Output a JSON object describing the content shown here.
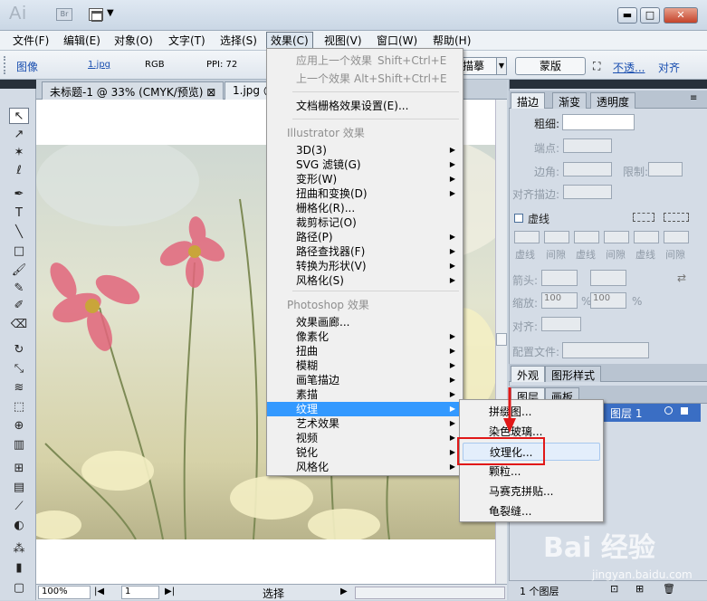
{
  "title_bar": {
    "app_logo": "Ai",
    "bridge_label": "Br",
    "arrange_icon": "arrange-documents-icon",
    "min": "▬",
    "max": "□",
    "close": "✕"
  },
  "menubar": [
    "文件(F)",
    "编辑(E)",
    "对象(O)",
    "文字(T)",
    "选择(S)",
    "效果(C)",
    "视图(V)",
    "窗口(W)",
    "帮助(H)"
  ],
  "control_bar": {
    "label": "图像",
    "file": "1.jpg",
    "mode": "RGB",
    "ppi": "PPI: 72",
    "trace": "描摹",
    "mask": "蒙版",
    "opacity": "不透...",
    "align": "对齐"
  },
  "doc_tabs": [
    {
      "label": "未标题-1 @ 33% (CMYK/预览)",
      "close": "⊠"
    },
    {
      "label": "1.jpg @"
    }
  ],
  "status_bar": {
    "zoom": "100%",
    "page": "1",
    "tool": "选择"
  },
  "effect_menu": {
    "top": [
      {
        "label": "应用上一个效果",
        "shortcut": "Shift+Ctrl+E",
        "disabled": true
      },
      {
        "label": "上一个效果",
        "shortcut": "Alt+Shift+Ctrl+E",
        "disabled": true
      },
      {
        "label": "文档栅格效果设置(E)..."
      }
    ],
    "illustrator_header": "Illustrator 效果",
    "illustrator": [
      "3D(3)",
      "SVG 滤镜(G)",
      "变形(W)",
      "扭曲和变换(D)",
      "栅格化(R)...",
      "裁剪标记(O)",
      "路径(P)",
      "路径查找器(F)",
      "转换为形状(V)",
      "风格化(S)"
    ],
    "illustrator_submenu": [
      true,
      true,
      true,
      true,
      false,
      false,
      true,
      true,
      true,
      true
    ],
    "photoshop_header": "Photoshop 效果",
    "photoshop": [
      "效果画廊...",
      "像素化",
      "扭曲",
      "模糊",
      "画笔描边",
      "素描",
      "纹理",
      "艺术效果",
      "视频",
      "锐化",
      "风格化"
    ],
    "photoshop_submenu": [
      false,
      true,
      true,
      true,
      true,
      true,
      true,
      true,
      true,
      true,
      true
    ],
    "highlighted": "纹理"
  },
  "texture_submenu": [
    "拼缀图...",
    "染色玻璃...",
    "纹理化...",
    "颗粒...",
    "马赛克拼贴...",
    "龟裂缝..."
  ],
  "texture_selected": "纹理化...",
  "panels": {
    "stroke_tabs": [
      "描边",
      "渐变",
      "透明度"
    ],
    "weight_label": "粗细:",
    "cap_label": "端点:",
    "corner_label": "边角:",
    "limit_label": "限制:",
    "align_stroke_label": "对齐描边:",
    "dashed_label": "虚线",
    "dash_cells": [
      "虚线",
      "间隙",
      "虚线",
      "间隙",
      "虚线",
      "间隙"
    ],
    "arrow_label": "箭头:",
    "scale_label": "缩放:",
    "scale_values": [
      "100",
      "100"
    ],
    "percent": "%",
    "align_label": "对齐:",
    "profile_label": "配置文件:",
    "appearance_tabs": [
      "外观",
      "图形样式"
    ],
    "layers_tabs": [
      "图层",
      "画板"
    ],
    "layer_name": "图层 1",
    "layer_count": "1 个图层"
  },
  "watermark": {
    "text": "Bai 经验",
    "url": "jingyan.baidu.com"
  },
  "colors": {
    "highlight": "#3399ff",
    "annotation_red": "#e11818",
    "layer_selected": "#3a6ec4"
  }
}
